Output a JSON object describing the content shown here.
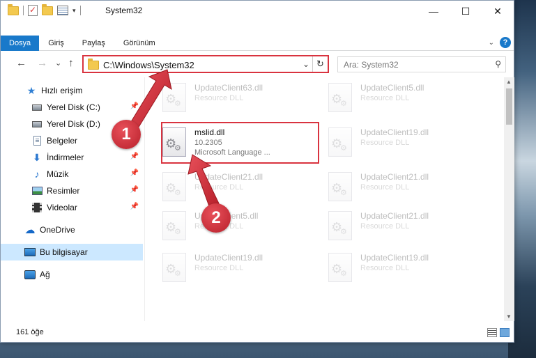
{
  "window": {
    "title": "System32",
    "controls": {
      "minimize": "—",
      "maximize": "☐",
      "close": "✕"
    }
  },
  "ribbon": {
    "tabs": [
      {
        "label": "Dosya"
      },
      {
        "label": "Giriş"
      },
      {
        "label": "Paylaş"
      },
      {
        "label": "Görünüm"
      }
    ],
    "collapse_glyph": "⌄",
    "help_glyph": "?"
  },
  "nav": {
    "back": "←",
    "forward": "→",
    "recent": "⌄",
    "up": "↑",
    "address": "C:\\Windows\\System32",
    "address_dropdown": "⌄",
    "refresh": "↻",
    "search_placeholder": "Ara: System32",
    "search_glyph": "⚲"
  },
  "sidebar": {
    "items": [
      {
        "label": "Hızlı erişim",
        "icon": "star-icon"
      },
      {
        "label": "Yerel Disk (C:)",
        "icon": "disk-icon",
        "pinned": true
      },
      {
        "label": "Yerel Disk (D:)",
        "icon": "disk-icon",
        "pinned": true
      },
      {
        "label": "Belgeler",
        "icon": "document-icon",
        "pinned": true
      },
      {
        "label": "İndirmeler",
        "icon": "download-icon",
        "pinned": true
      },
      {
        "label": "Müzik",
        "icon": "music-icon",
        "pinned": true
      },
      {
        "label": "Resimler",
        "icon": "pictures-icon",
        "pinned": true
      },
      {
        "label": "Videolar",
        "icon": "videos-icon",
        "pinned": true
      },
      {
        "label": "OneDrive",
        "icon": "onedrive-icon"
      },
      {
        "label": "Bu bilgisayar",
        "icon": "computer-icon",
        "selected": true
      },
      {
        "label": "Ağ",
        "icon": "network-icon"
      }
    ],
    "pin_glyph": "📌"
  },
  "files": [
    {
      "name": "UpdateClient63.dll",
      "type": "Resource DLL",
      "faded": true
    },
    {
      "name": "UpdateClient5.dll",
      "type": "Resource DLL",
      "faded": true
    },
    {
      "name": "mslid.dll",
      "version": "10.2305",
      "desc": "Microsoft Language ...",
      "faded": false
    },
    {
      "name": "UpdateClient19.dll",
      "type": "Resource DLL",
      "faded": true
    },
    {
      "name": "UpdateClient21.dll",
      "type": "Resource DLL",
      "faded": true
    },
    {
      "name": "UpdateClient21.dll",
      "type": "Resource DLL",
      "faded": true
    },
    {
      "name": "UpdateClient5.dll",
      "type": "Resource DLL",
      "faded": true
    },
    {
      "name": "UpdateClient21.dll",
      "type": "Resource DLL",
      "faded": true
    },
    {
      "name": "UpdateClient19.dll",
      "type": "Resource DLL",
      "faded": true
    },
    {
      "name": "UpdateClient19.dll",
      "type": "Resource DLL",
      "faded": true
    }
  ],
  "status": {
    "count": "161 öğe"
  },
  "annotations": [
    {
      "number": "1"
    },
    {
      "number": "2"
    }
  ],
  "colors": {
    "accent": "#1979ca",
    "highlight_red": "#d9333f",
    "selected_bg": "#cce8ff"
  }
}
